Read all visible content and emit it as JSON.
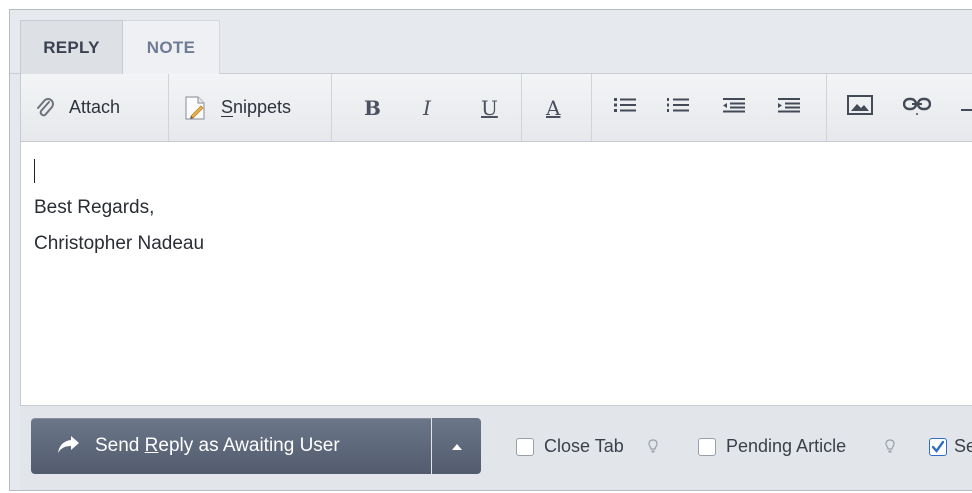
{
  "tabs": [
    {
      "label": "REPLY",
      "active": true
    },
    {
      "label": "NOTE",
      "active": false
    }
  ],
  "toolbar": {
    "attach_label": "Attach",
    "snippets_label": "Snippets",
    "bold_label": "B",
    "italic_label": "I",
    "underline_label": "U",
    "font_color_label": "A"
  },
  "editor": {
    "lines": [
      "",
      "Best Regards,",
      "Christopher Nadeau"
    ]
  },
  "footer": {
    "send_label": "Send Reply as Awaiting User",
    "close_tab_label": "Close Tab",
    "close_tab_checked": false,
    "pending_article_label": "Pending Article",
    "pending_article_checked": false,
    "third_option_label": "Se",
    "third_option_checked": true
  },
  "colors": {
    "send_button": "#5f6a7d",
    "checkbox_checked": "#2f6ec4",
    "tab_inactive_text": "#6f7c96"
  },
  "icons": [
    "paperclip-icon",
    "snippet-document-icon",
    "bullet-list-icon",
    "numbered-list-icon",
    "outdent-icon",
    "indent-icon",
    "image-icon",
    "link-icon",
    "horizontal-rule-icon",
    "reply-arrow-icon",
    "caret-up-icon",
    "hint-bulb-icon",
    "checkmark-icon"
  ]
}
